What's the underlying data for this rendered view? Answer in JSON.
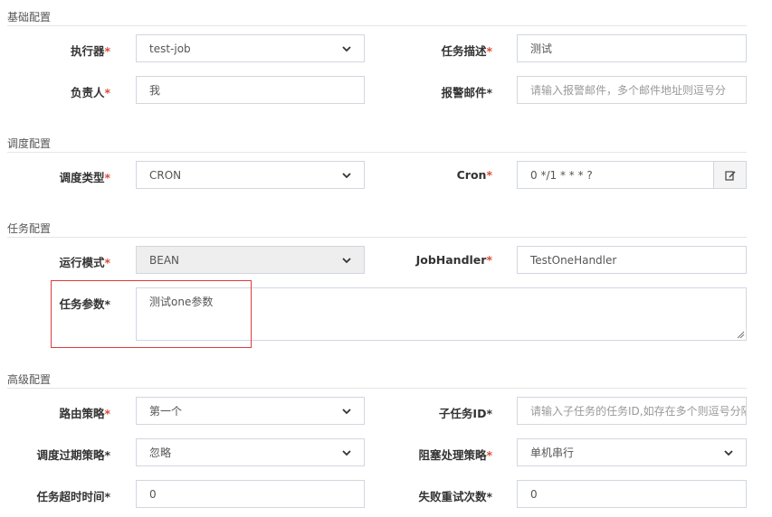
{
  "sections": {
    "basic": "基础配置",
    "schedule": "调度配置",
    "task": "任务配置",
    "advanced": "高级配置"
  },
  "fields": {
    "executor": {
      "label": "执行器",
      "value": "test-job",
      "icon": "chevron-down-icon"
    },
    "job_desc": {
      "label": "任务描述",
      "value": "测试"
    },
    "author": {
      "label": "负责人",
      "value": "我"
    },
    "alarm_email": {
      "label": "报警邮件",
      "placeholder": "请输入报警邮件，多个邮件地址则逗号分"
    },
    "schedule_type": {
      "label": "调度类型",
      "value": "CRON",
      "icon": "chevron-down-icon"
    },
    "cron": {
      "label": "Cron",
      "value": "0 */1 * * * ?",
      "icon": "edit-icon"
    },
    "glue_type": {
      "label": "运行模式",
      "value": "BEAN",
      "icon": "chevron-down-icon"
    },
    "job_handler": {
      "label": "JobHandler",
      "value": "TestOneHandler"
    },
    "job_param": {
      "label": "任务参数",
      "value": "测试one参数"
    },
    "route_strategy": {
      "label": "路由策略",
      "value": "第一个",
      "icon": "chevron-down-icon"
    },
    "child_job_id": {
      "label": "子任务ID",
      "placeholder": "请输入子任务的任务ID,如存在多个则逗号分隔"
    },
    "misfire_strategy": {
      "label": "调度过期策略",
      "value": "忽略",
      "icon": "chevron-down-icon"
    },
    "block_strategy": {
      "label": "阻塞处理策略",
      "value": "单机串行",
      "icon": "chevron-down-icon"
    },
    "timeout": {
      "label": "任务超时时间",
      "value": "0"
    },
    "fail_retry": {
      "label": "失败重试次数",
      "value": "0"
    }
  },
  "required_mark": "*",
  "colors": {
    "required": "#dd4b39",
    "highlight_border": "#e03b3b",
    "input_border": "#d2d6de"
  }
}
